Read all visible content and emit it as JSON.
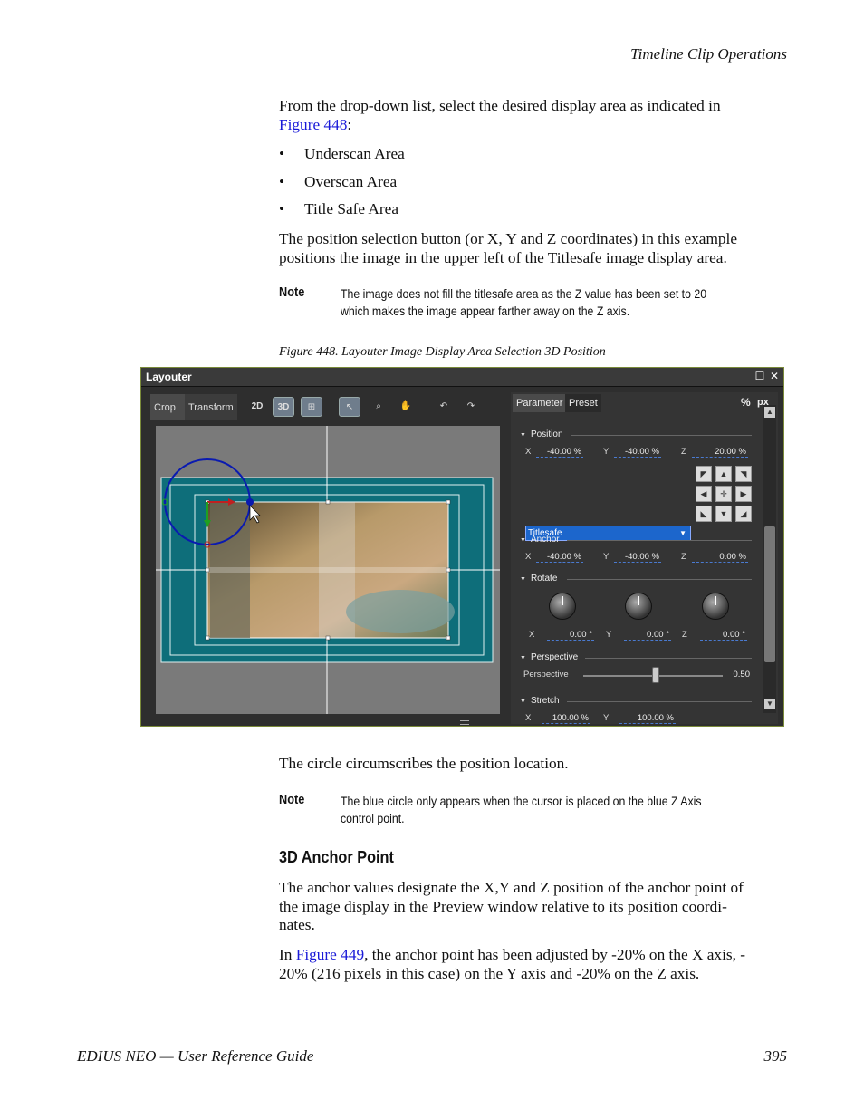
{
  "header": {
    "chapter": "Timeline Clip Operations"
  },
  "intro": {
    "pre": "From the drop-down list, select the desired display area as indicated in",
    "link": "Figure 448",
    "post": ":"
  },
  "bullets": [
    "Underscan Area",
    "Overscan Area",
    "Title Safe Area"
  ],
  "para_position": {
    "line1": "The position selection button (or X, Y and Z coordinates) in this example",
    "line2": "positions the image in the upper left of the Titlesafe image display area."
  },
  "note1": {
    "label": "Note",
    "line1": "The image does not fill the titlesafe area as the Z value has been set to 20",
    "line2": "which makes the image appear farther away on the Z axis."
  },
  "figure": {
    "caption": "Figure 448.  Layouter Image Display Area Selection 3D Position",
    "window_title": "Layouter",
    "tabs": [
      "Crop",
      "Transform"
    ],
    "toolbar": [
      "2D",
      "3D"
    ],
    "right_tabs": [
      "Parameter",
      "Preset"
    ],
    "unit_buttons": [
      "%",
      "px"
    ],
    "position": {
      "label": "Position",
      "x_label": "X",
      "x": "-40.00",
      "y_label": "Y",
      "y": "-40.00",
      "z_label": "Z",
      "z": "20.00",
      "unit": "%"
    },
    "dropdown": "Titlesafe",
    "anchor": {
      "label": "Anchor",
      "x_label": "X",
      "x": "-40.00",
      "y_label": "Y",
      "y": "-40.00",
      "z_label": "Z",
      "z": "0.00",
      "unit": "%"
    },
    "rotate": {
      "label": "Rotate",
      "x_label": "X",
      "x": "0.00",
      "y_label": "Y",
      "y": "0.00",
      "z_label": "Z",
      "z": "0.00",
      "unit": "°"
    },
    "perspective": {
      "label": "Perspective",
      "param_label": "Perspective",
      "value": "0.50",
      "slider_fraction": 0.52
    },
    "stretch": {
      "label": "Stretch",
      "x_label": "X",
      "x": "100.00",
      "y_label": "Y",
      "y": "100.00",
      "unit": "%"
    },
    "colors": {
      "area": "#0e6e7a",
      "canvas": "#7a7a7a",
      "circle": "#0a1ab0",
      "dropdown": "#1c66cc"
    }
  },
  "para_circle": "The circle circumscribes the position location.",
  "note2": {
    "label": "Note",
    "line1": "The blue circle only appears when the cursor is placed on the blue Z Axis",
    "line2": "control point."
  },
  "heading": "3D Anchor Point",
  "para_anchor": {
    "line1": "The anchor values designate the X,Y and Z position of the anchor point of",
    "line2": "the image display in the Preview window relative to its position coordi-",
    "line3": "nates."
  },
  "para_figure449": {
    "pre": "In",
    "link": "Figure 449",
    "line1_post": ", the anchor point has been adjusted by -20% on the X axis, -",
    "line2": "20% (216 pixels in this case) on the Y axis and -20% on the Z axis."
  },
  "footer": {
    "left": "EDIUS NEO  —  User Reference Guide",
    "page": "395"
  }
}
